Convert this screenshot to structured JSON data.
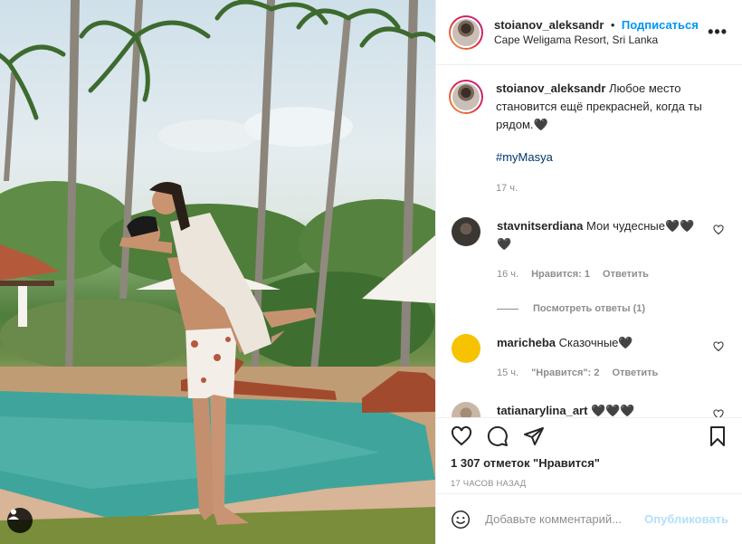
{
  "post": {
    "username": "stoianov_aleksandr",
    "dot": "•",
    "follow_label": "Подписаться",
    "location": "Cape Weligama Resort, Sri Lanka",
    "more_label": "•••"
  },
  "caption": {
    "username": "stoianov_aleksandr",
    "text": "Любое место становится ещё прекрасней, когда ты рядом.🖤",
    "hashtag": "#myMasya",
    "time": "17 ч."
  },
  "comments": [
    {
      "username": "stavnitserdiana",
      "text": "Мои чудесные🖤🖤🖤",
      "time": "16 ч.",
      "likes": "Нравится: 1",
      "reply": "Ответить",
      "avatar_color": "#3b3733"
    },
    {
      "username": "maricheba",
      "text": "Сказочные🖤",
      "time": "15 ч.",
      "likes": "\"Нравится\": 2",
      "reply": "Ответить",
      "avatar_color": "#f6c300"
    },
    {
      "username": "tatianarylina_art",
      "text": "🖤🖤🖤",
      "avatar_color": "#c9b7a6"
    }
  ],
  "view_replies": "Посмотреть ответы (1)",
  "actions": {
    "likes": "1 307 отметок \"Нравится\"",
    "date": "17 ЧАСОВ НАЗАД"
  },
  "add_comment": {
    "placeholder": "Добавьте комментарий...",
    "publish_label": "Опубликовать"
  },
  "colors": {
    "accent": "#0095f6",
    "publish_disabled": "#b2dffc",
    "muted": "#8e8e8e"
  }
}
